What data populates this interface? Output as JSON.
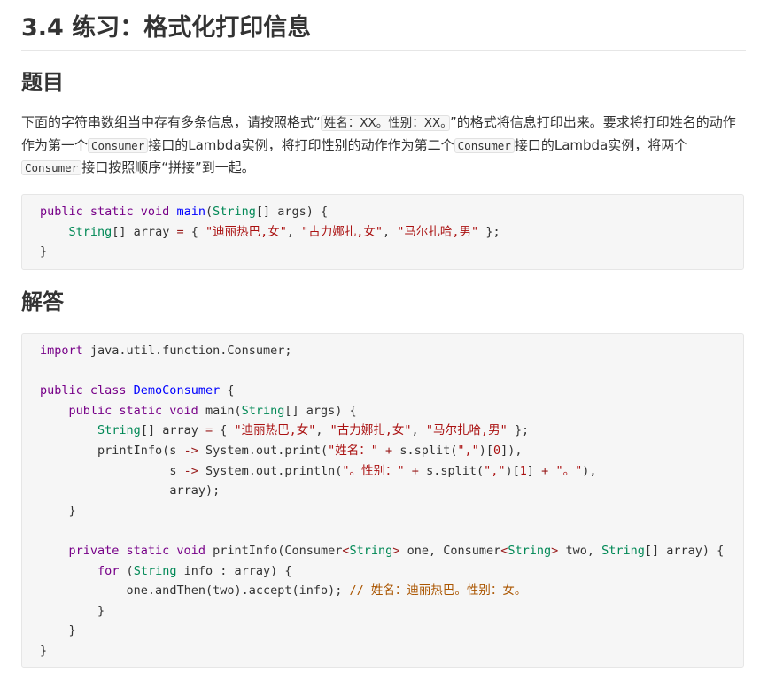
{
  "section_title": "3.4 练习：格式化打印信息",
  "problem": {
    "heading": "题目",
    "text_1": "下面的字符串数组当中存有多条信息，请按照格式“",
    "format_code": "姓名：XX。性别：XX。",
    "text_2": "”的格式将信息打印出来。要求将打印姓名的动作作为第一个",
    "consumer_1": "Consumer",
    "text_3": "接口的Lambda实例，将打印性别的动作作为第二个",
    "consumer_2": "Consumer",
    "text_4": "接口的Lambda实例，将两个",
    "consumer_3": "Consumer",
    "text_5": "接口按照顺序“拼接”到一起。",
    "code": {
      "l1_kw": "public static void ",
      "l1_fn": "main",
      "l1_p1": "(",
      "l1_ty": "String",
      "l1_p2": "[] args) {",
      "l2_indent": "    ",
      "l2_ty": "String",
      "l2_p1": "[] array ",
      "l2_eq": "=",
      "l2_p2": " { ",
      "s1": "\"迪丽热巴,女\"",
      "c1": ", ",
      "s2": "\"古力娜扎,女\"",
      "c2": ", ",
      "s3": "\"马尔扎哈,男\"",
      "l2_end": " };",
      "l3": "}"
    }
  },
  "answer": {
    "heading": "解答",
    "code": {
      "import_kw": "import",
      "import_rest": " java.util.function.Consumer;",
      "class_kw": "public class ",
      "class_name": "DemoConsumer",
      "class_open": " {",
      "main_indent": "    ",
      "main_kw": "public static void",
      "main_rest": " main(",
      "main_ty": "String",
      "main_end": "[] args) {",
      "arr_indent": "        ",
      "arr_ty": "String",
      "arr_p1": "[] array ",
      "arr_eq": "=",
      "arr_p2": " { ",
      "s1": "\"迪丽热巴,女\"",
      "c1": ", ",
      "s2": "\"古力娜扎,女\"",
      "c2": ", ",
      "s3": "\"马尔扎哈,男\"",
      "arr_end": " };",
      "pi_indent": "        ",
      "pi_p1": "printInfo(s ",
      "pi_arrow": "->",
      "pi_p2": " System.out.print(",
      "pi_s1": "\"姓名：\"",
      "pi_plus": " + ",
      "pi_p3": "s.split(",
      "pi_s2": "\",\"",
      "pi_p4": ")[",
      "pi_n0": "0",
      "pi_p5": "]),",
      "pl_indent": "                  ",
      "pl_p1": "s ",
      "pl_arrow": "->",
      "pl_p2": " System.out.println(",
      "pl_s1": "\"。性别：\"",
      "pl_plus1": " + ",
      "pl_p3": "s.split(",
      "pl_s2": "\",\"",
      "pl_p4": ")[",
      "pl_n1": "1",
      "pl_p5": "] ",
      "pl_plus2": "+",
      "pl_sp": " ",
      "pl_s3": "\"。\"",
      "pl_p6": "),",
      "arr2_indent": "                  ",
      "arr2": "array);",
      "close_main": "    }",
      "pv_indent": "    ",
      "pv_kw": "private static void",
      "pv_p1": " printInfo(Consumer",
      "pv_lt1": "<",
      "pv_ty1": "String",
      "pv_gt1": ">",
      "pv_p2": " one, Consumer",
      "pv_lt2": "<",
      "pv_ty2": "String",
      "pv_gt2": ">",
      "pv_p3": " two, ",
      "pv_ty3": "String",
      "pv_p4": "[] array) {",
      "for_indent": "        ",
      "for_kw": "for",
      "for_p1": " (",
      "for_ty": "String",
      "for_p2": " info : array) {",
      "then_indent": "            ",
      "then_code": "one.andThen(two).accept(info); ",
      "then_comment": "// 姓名：迪丽热巴。性别：女。",
      "close_for": "        }",
      "close_method": "    }",
      "close_class": "}"
    }
  }
}
